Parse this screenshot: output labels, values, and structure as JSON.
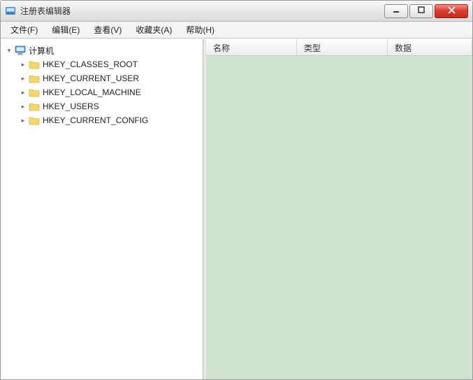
{
  "window": {
    "title": "注册表编辑器"
  },
  "menubar": {
    "items": [
      {
        "label": "文件(F)"
      },
      {
        "label": "编辑(E)"
      },
      {
        "label": "查看(V)"
      },
      {
        "label": "收藏夹(A)"
      },
      {
        "label": "帮助(H)"
      }
    ]
  },
  "tree": {
    "root": {
      "label": "计算机",
      "expanded": true,
      "children": [
        {
          "label": "HKEY_CLASSES_ROOT"
        },
        {
          "label": "HKEY_CURRENT_USER"
        },
        {
          "label": "HKEY_LOCAL_MACHINE"
        },
        {
          "label": "HKEY_USERS"
        },
        {
          "label": "HKEY_CURRENT_CONFIG"
        }
      ]
    }
  },
  "list": {
    "columns": {
      "name": "名称",
      "type": "类型",
      "data": "数据"
    }
  },
  "glyphs": {
    "expander_open": "▾",
    "expander_closed": "▸"
  }
}
